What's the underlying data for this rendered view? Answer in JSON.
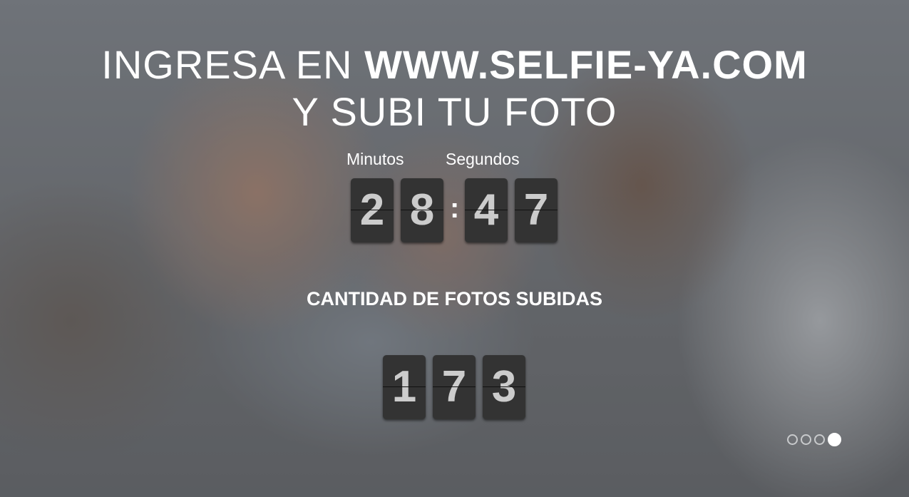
{
  "headline": {
    "prefix": "INGRESA EN ",
    "site": "WWW.SELFIE-YA.COM",
    "suffix": " Y SUBI TU FOTO"
  },
  "countdown": {
    "minutes_label": "Minutos",
    "seconds_label": "Segundos",
    "digits": [
      "2",
      "8",
      "4",
      "7"
    ],
    "separator": ":"
  },
  "photos": {
    "label": "CANTIDAD DE FOTOS SUBIDAS",
    "digits": [
      "1",
      "7",
      "3"
    ]
  },
  "carousel": {
    "slides": 4,
    "active": 4
  }
}
